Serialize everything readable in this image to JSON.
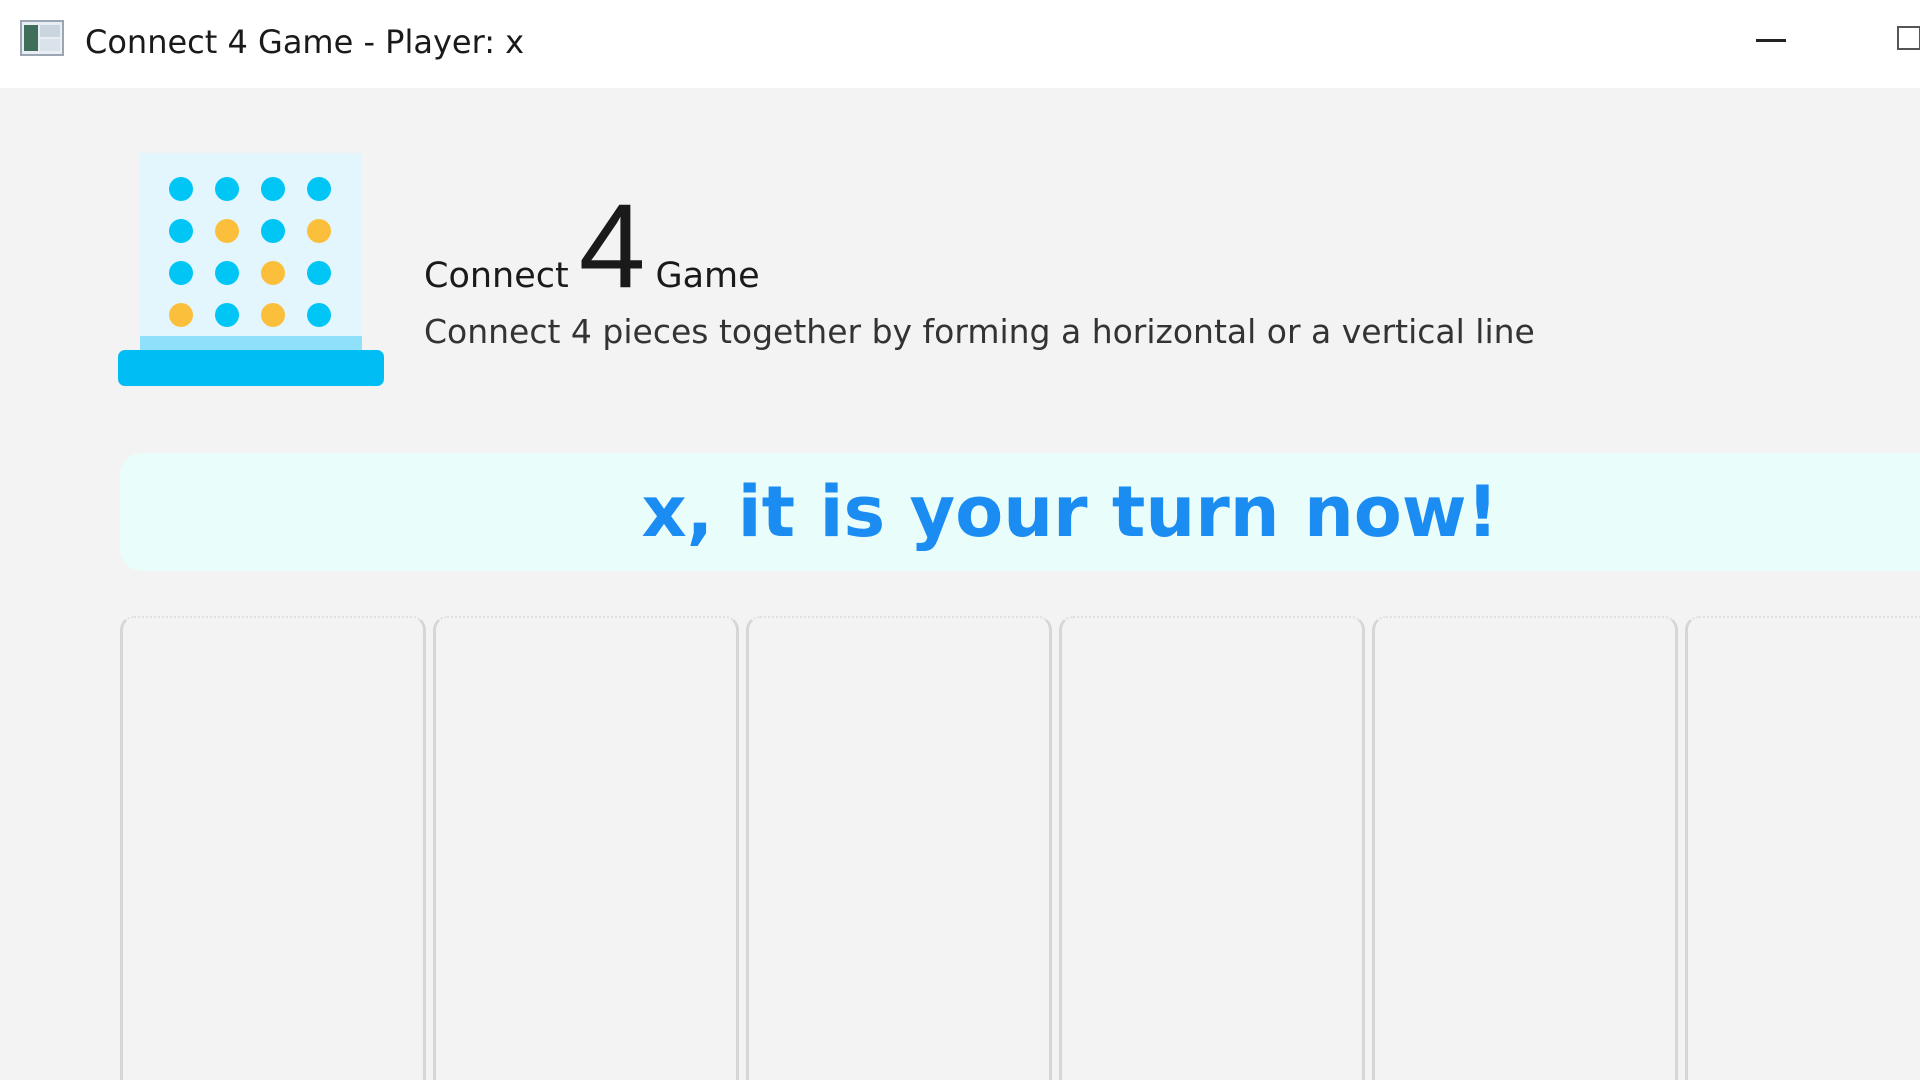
{
  "window": {
    "title": "Connect 4 Game - Player: x",
    "app_icon": "app-window-icon",
    "controls": [
      "minimize-icon",
      "maximize-icon"
    ]
  },
  "header": {
    "title_prefix": "Connect",
    "title_number": "4",
    "title_suffix": "Game",
    "subtitle": "Connect 4 pieces together by forming a horizontal or a vertical line",
    "logo_icon": "connect-four-board-icon"
  },
  "status": {
    "message": "x, it is your turn now!"
  },
  "board": {
    "visible_columns": 6
  },
  "colors": {
    "accent_cyan": "#00c6f6",
    "accent_yellow": "#fbbf3c",
    "turn_text": "#1b8cf2",
    "banner_bg": "#e9fdfb",
    "board_bg": "#e3f6fd",
    "board_base": "#00bdf4",
    "board_base_light": "#8fe1fb"
  }
}
